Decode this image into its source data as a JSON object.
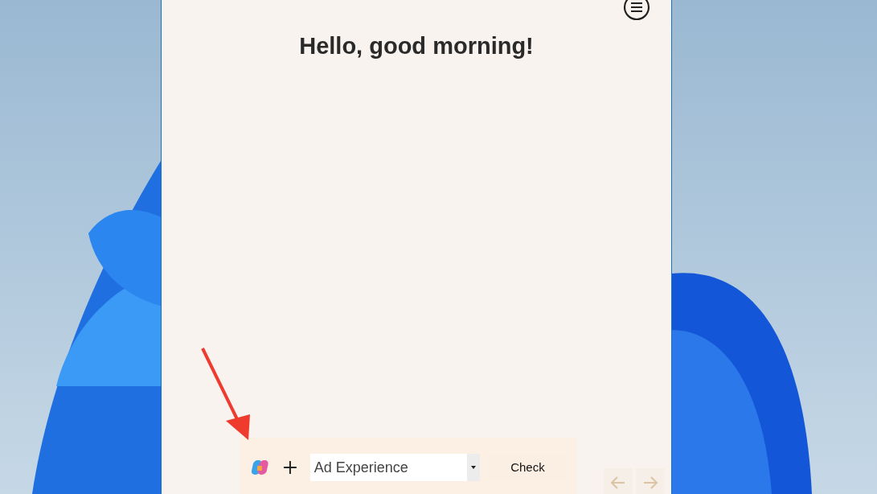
{
  "greeting": "Hello, good morning!",
  "toolbar": {
    "dropdown": {
      "value": "Ad Experience"
    },
    "check_button": "Check"
  },
  "nav": [
    {
      "kind": "back",
      "disabled": true
    },
    {
      "kind": "forward",
      "disabled": true
    }
  ]
}
